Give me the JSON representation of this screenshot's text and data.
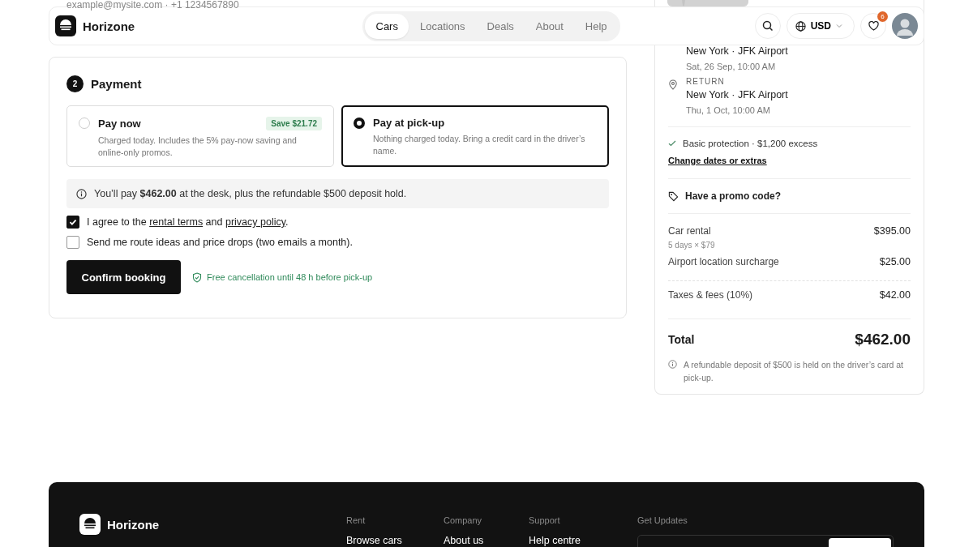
{
  "header": {
    "brand": "Horizone",
    "nav": [
      {
        "label": "Cars",
        "selected": true
      },
      {
        "label": "Locations",
        "selected": false
      },
      {
        "label": "Deals",
        "selected": false
      },
      {
        "label": "About",
        "selected": false
      },
      {
        "label": "Help",
        "selected": false
      }
    ],
    "currency": "USD",
    "wishlist_count": "6"
  },
  "contact_line": "example@mysite.com · +1 1234567890",
  "payment": {
    "step": "2",
    "title": "Payment",
    "options": [
      {
        "title": "Pay now",
        "description": "Charged today. Includes the 5% pay-now saving and online-only promos.",
        "badge": "Save $21.72",
        "selected": false
      },
      {
        "title": "Pay at pick-up",
        "description": "Nothing charged today. Bring a credit card in the driver’s name.",
        "selected": true
      }
    ],
    "notice": "You’ll pay **$462.00** at the desk, plus the refundable $500 deposit hold.",
    "consents": [
      {
        "checked": true,
        "segments": [
          {
            "text": "I agree to the ",
            "link": false
          },
          {
            "text": "rental terms",
            "link": true
          },
          {
            "text": " and ",
            "link": false
          },
          {
            "text": "privacy policy",
            "link": true
          },
          {
            "text": ".",
            "link": false
          }
        ]
      },
      {
        "checked": false,
        "segments": [
          {
            "text": "Send me route ideas and price drops (two emails a month).",
            "link": false
          }
        ]
      }
    ],
    "confirm_button": "Confirm booking",
    "cancellation_note": "Free cancellation until 48 h before pick-up"
  },
  "summary": {
    "pickup": {
      "location": "New York · JFK Airport",
      "datetime": "Sat, 26 Sep, 10:00 AM"
    },
    "return": {
      "label": "RETURN",
      "location": "New York · JFK Airport",
      "datetime": "Thu, 1 Oct, 10:00 AM"
    },
    "protection": "Basic protection · $1,200 excess",
    "change_link": "Change dates or extras",
    "promo": "Have a promo code?",
    "lines": [
      {
        "label": "Car rental",
        "detail": "5 days × $79",
        "amount": "$395.00",
        "separated": false
      },
      {
        "label": "Airport location surcharge",
        "amount": "$25.00",
        "separated": false
      },
      {
        "label": "Taxes & fees (10%)",
        "amount": "$42.00",
        "separated": true
      }
    ],
    "total": {
      "label": "Total",
      "amount": "$462.00"
    },
    "deposit_note": "A refundable deposit of $500 is held on the driver’s card at pick-up."
  },
  "footer": {
    "brand": "Horizone",
    "columns": [
      {
        "heading": "Rent",
        "links": [
          "Browse cars"
        ]
      },
      {
        "heading": "Company",
        "links": [
          "About us"
        ]
      },
      {
        "heading": "Support",
        "links": [
          "Help centre"
        ]
      }
    ],
    "updates_heading": "Get Updates"
  }
}
